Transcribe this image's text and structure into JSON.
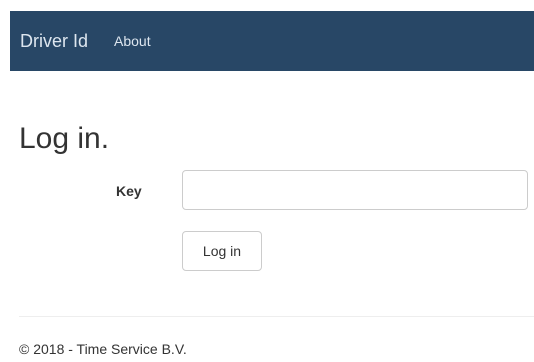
{
  "navbar": {
    "brand": "Driver Id",
    "links": [
      {
        "label": "About"
      }
    ]
  },
  "main": {
    "title": "Log in.",
    "form": {
      "key_label": "Key",
      "key_value": "",
      "submit_label": "Log in"
    }
  },
  "footer": {
    "text": "© 2018 - Time Service B.V."
  },
  "colors": {
    "navbar_bg": "#284766",
    "navbar_text": "#dde6ef"
  }
}
